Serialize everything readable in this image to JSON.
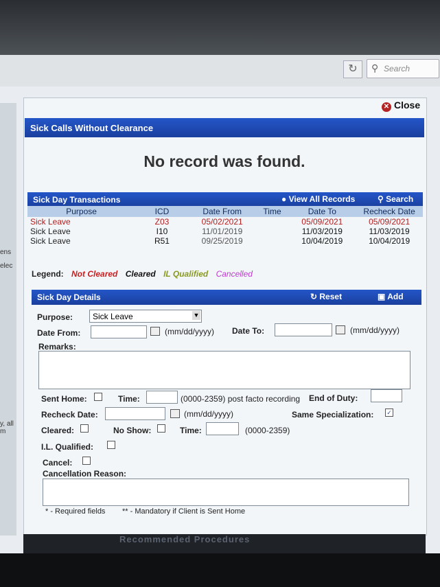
{
  "browser": {
    "search_placeholder": "Search",
    "refresh_icon": "refresh-icon"
  },
  "left_fragments": [
    "ens",
    "elec",
    "y, all m"
  ],
  "modal": {
    "close_label": "Close",
    "sick_calls_title": "Sick Calls Without Clearance",
    "no_record": "No record was found.",
    "transactions": {
      "title": "Sick Day Transactions",
      "view_all": "View All Records",
      "search": "Search",
      "columns": [
        "Purpose",
        "ICD",
        "Date From",
        "Time",
        "Date To",
        "Recheck Date"
      ],
      "rows": [
        {
          "purpose": "Sick Leave",
          "icd": "Z03",
          "date_from": "05/02/2021",
          "time": "",
          "date_to": "05/09/2021",
          "recheck": "05/09/2021",
          "status": "not-cleared"
        },
        {
          "purpose": "Sick Leave",
          "icd": "I10",
          "date_from": "11/01/2019",
          "time": "",
          "date_to": "11/03/2019",
          "recheck": "11/03/2019",
          "status": "cleared"
        },
        {
          "purpose": "Sick Leave",
          "icd": "R51",
          "date_from": "09/25/2019",
          "time": "",
          "date_to": "10/04/2019",
          "recheck": "10/04/2019",
          "status": "cleared"
        }
      ]
    },
    "legend": {
      "label": "Legend:",
      "not_cleared": "Not Cleared",
      "cleared": "Cleared",
      "il_qualified": "IL Qualified",
      "cancelled": "Cancelled",
      "colors": {
        "not_cleared": "#c81e1e",
        "cleared": "#111111",
        "il_qualified": "#8a9a1e",
        "cancelled": "#c13ad0"
      }
    },
    "details": {
      "title": "Sick Day Details",
      "reset": "Reset",
      "add": "Add",
      "purpose_label": "Purpose:",
      "purpose_value": "Sick Leave",
      "date_from_label": "Date From:",
      "date_format": "(mm/dd/yyyy)",
      "date_to_label": "Date To:",
      "remarks_label": "Remarks:",
      "sent_home_label": "Sent Home:",
      "time_label": "Time:",
      "time_hint_postfacto": "(0000-2359) post facto recording",
      "end_of_duty_label": "End of Duty:",
      "recheck_date_label": "Recheck Date:",
      "same_spec_label": "Same Specialization:",
      "same_spec_checked": true,
      "cleared_label": "Cleared:",
      "no_show_label": "No Show:",
      "time_hint": "(0000-2359)",
      "il_qualified_label": "I.L. Qualified:",
      "cancel_label": "Cancel:",
      "cancel_reason_label": "Cancellation Reason:",
      "required_note": "* - Required fields",
      "mandatory_note": "** - Mandatory if Client is Sent Home"
    }
  },
  "footer_text": "Recommended Procedures"
}
